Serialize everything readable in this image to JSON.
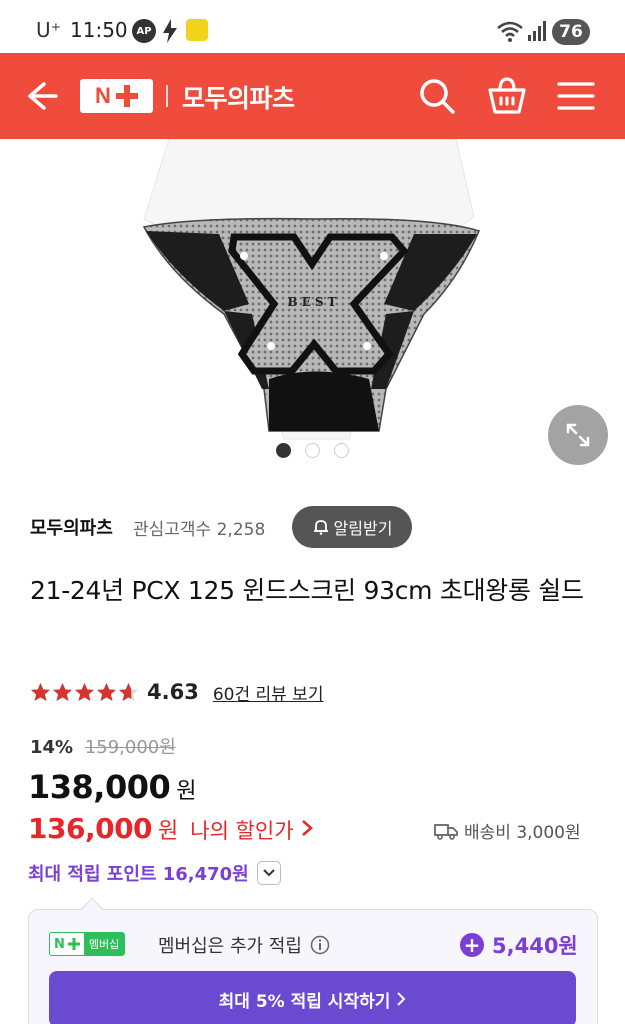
{
  "status_bar": {
    "carrier": "U⁺",
    "time": "11:50",
    "ap_label": "AP",
    "battery": "76"
  },
  "header": {
    "logo_n": "N",
    "store_name": "모두의파츠",
    "bg_color": "#f04c3e"
  },
  "gallery": {
    "image_text": "BEST",
    "dot_count": 3,
    "active_dot": 0
  },
  "seller": {
    "name": "모두의파츠",
    "interest": "관심고객수 2,258",
    "alert_label": "알림받기"
  },
  "product": {
    "title": "21-24년 PCX 125 윈드스크린 93cm 초대왕롱 쉴드",
    "rating": "4.63",
    "rating_stars": 4.63,
    "review_link": "60건 리뷰 보기",
    "discount_rate": "14%",
    "original_price": "159,000원",
    "price": "138,000",
    "price_unit": "원",
    "member_price": "136,000",
    "member_price_unit": "원",
    "my_discount": "나의 할인가",
    "shipping": "배송비 3,000원",
    "max_points": "최대 적립 포인트 16,470원"
  },
  "membership": {
    "badge_label": "멤버십",
    "text": "멤버십은 추가 적립",
    "points": "5,440원",
    "cta": "최대 5% 적립 시작하기"
  }
}
